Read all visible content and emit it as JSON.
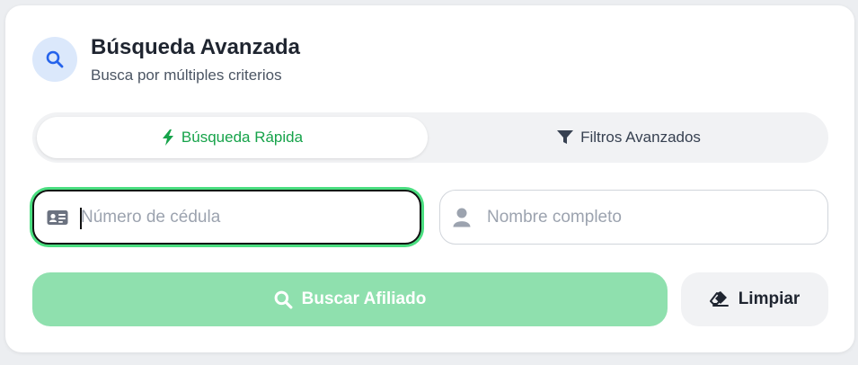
{
  "header": {
    "title": "Búsqueda Avanzada",
    "subtitle": "Busca por múltiples criterios",
    "icon": "search-icon"
  },
  "tabs": [
    {
      "label": "Búsqueda Rápida",
      "icon": "bolt-icon",
      "active": true
    },
    {
      "label": "Filtros Avanzados",
      "icon": "filter-icon",
      "active": false
    }
  ],
  "fields": {
    "cedula": {
      "placeholder": "Número de cédula",
      "value": "",
      "icon": "id-card-icon"
    },
    "nombre": {
      "placeholder": "Nombre completo",
      "value": "",
      "icon": "user-icon"
    }
  },
  "actions": {
    "search_label": "Buscar Afiliado",
    "clear_label": "Limpiar"
  },
  "colors": {
    "accent": "#16a34a",
    "search_button": "#8fe0ae",
    "focus_ring": "#4ade80",
    "icon_badge": "#dbe8fb"
  }
}
